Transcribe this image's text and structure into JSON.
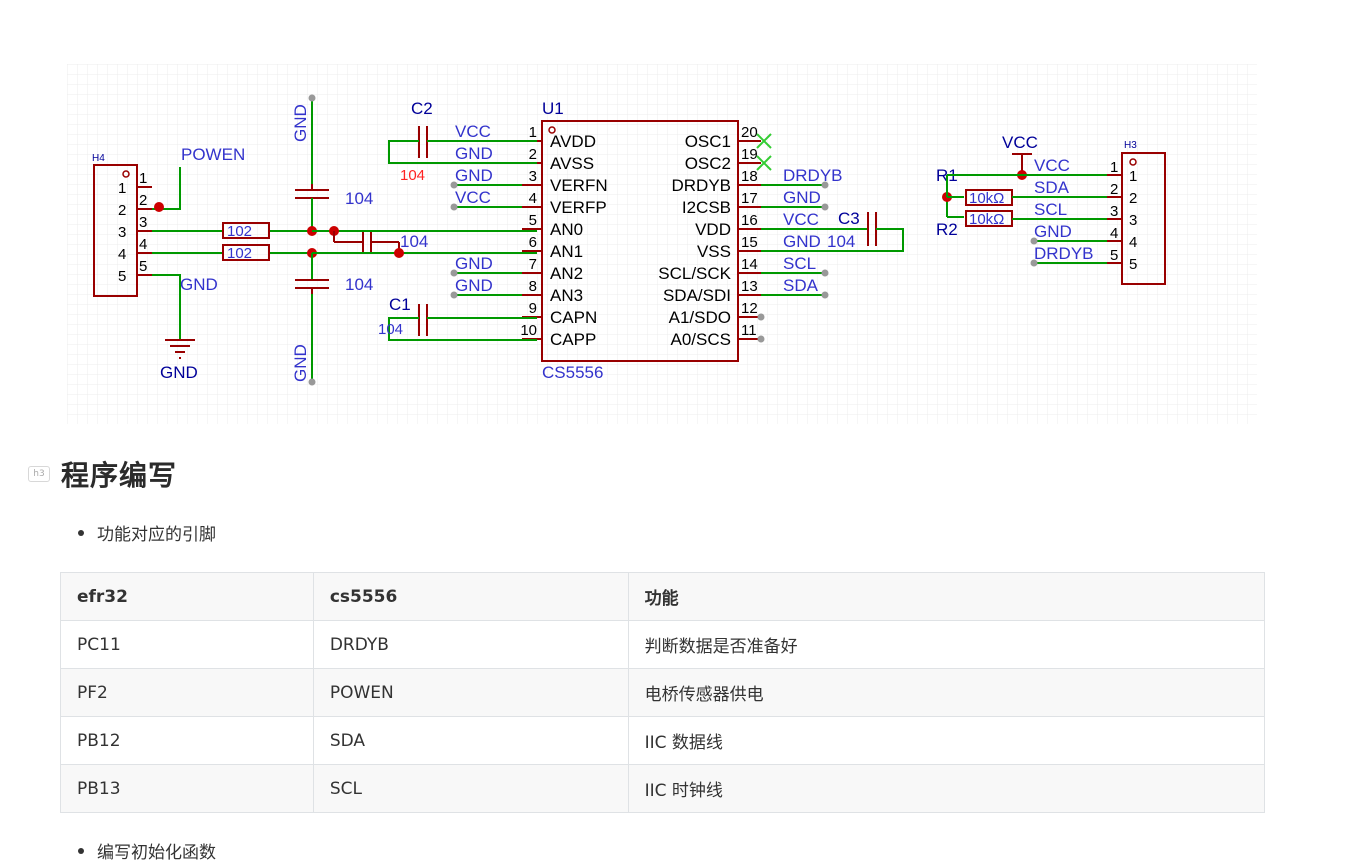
{
  "schematic": {
    "h4": {
      "ref": "H4",
      "pins": [
        "1",
        "2",
        "3",
        "4",
        "5"
      ],
      "net_powen": "POWEN",
      "net_gnd": "GND",
      "gnd_symbol": "GND",
      "r_top": "102",
      "r_bot": "102"
    },
    "gnd_top": "GND",
    "gnd_bot": "GND",
    "cap_a": "104",
    "cap_b": "104",
    "cap_c": "104",
    "c2": {
      "ref": "C2",
      "value": "104"
    },
    "c1": {
      "ref": "C1",
      "value": "104"
    },
    "c3": {
      "ref": "C3",
      "value": "104"
    },
    "u1": {
      "ref": "U1",
      "part": "CS5556",
      "left_pins": [
        {
          "num": "1",
          "name": "AVDD",
          "net": "VCC"
        },
        {
          "num": "2",
          "name": "AVSS",
          "net": "GND"
        },
        {
          "num": "3",
          "name": "VERFN",
          "net": "GND"
        },
        {
          "num": "4",
          "name": "VERFP",
          "net": "VCC"
        },
        {
          "num": "5",
          "name": "AN0",
          "net": ""
        },
        {
          "num": "6",
          "name": "AN1",
          "net": "104"
        },
        {
          "num": "7",
          "name": "AN2",
          "net": "GND"
        },
        {
          "num": "8",
          "name": "AN3",
          "net": "GND"
        },
        {
          "num": "9",
          "name": "CAPN",
          "net": ""
        },
        {
          "num": "10",
          "name": "CAPP",
          "net": ""
        }
      ],
      "right_pins": [
        {
          "num": "20",
          "name": "OSC1",
          "net": ""
        },
        {
          "num": "19",
          "name": "OSC2",
          "net": ""
        },
        {
          "num": "18",
          "name": "DRDYB",
          "net": "DRDYB"
        },
        {
          "num": "17",
          "name": "I2CSB",
          "net": "GND"
        },
        {
          "num": "16",
          "name": "VDD",
          "net": "VCC"
        },
        {
          "num": "15",
          "name": "VSS",
          "net": "GND"
        },
        {
          "num": "14",
          "name": "SCL/SCK",
          "net": "SCL"
        },
        {
          "num": "13",
          "name": "SDA/SDI",
          "net": "SDA"
        },
        {
          "num": "12",
          "name": "A1/SDO",
          "net": ""
        },
        {
          "num": "11",
          "name": "A0/SCS",
          "net": ""
        }
      ]
    },
    "h3": {
      "ref": "H3",
      "vcc": "VCC",
      "r1": "R1",
      "r2": "R2",
      "r1_val": "10kΩ",
      "r2_val": "10kΩ",
      "pins": [
        {
          "num": "1",
          "net": "VCC"
        },
        {
          "num": "2",
          "net": "SDA"
        },
        {
          "num": "3",
          "net": "SCL"
        },
        {
          "num": "4",
          "net": "GND"
        },
        {
          "num": "5",
          "net": "DRDYB"
        }
      ]
    }
  },
  "section": {
    "badge": "h3",
    "title": "程序编写"
  },
  "bullets": [
    "功能对应的引脚",
    "编写初始化函数"
  ],
  "table": {
    "headers": [
      "efr32",
      "cs5556",
      "功能"
    ],
    "rows": [
      [
        "PC11",
        "DRDYB",
        "判断数据是否准备好"
      ],
      [
        "PF2",
        "POWEN",
        "电桥传感器供电"
      ],
      [
        "PB12",
        "SDA",
        "IIC 数据线"
      ],
      [
        "PB13",
        "SCL",
        "IIC 时钟线"
      ]
    ]
  }
}
